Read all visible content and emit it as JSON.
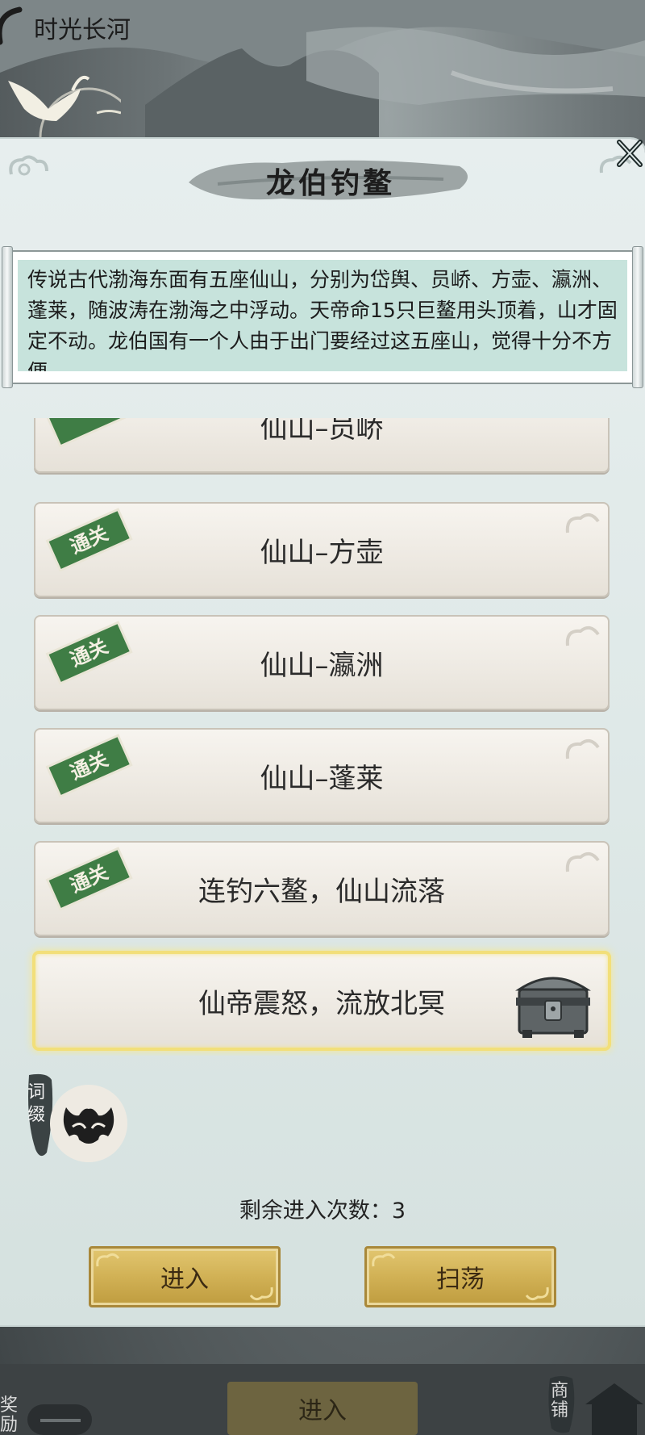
{
  "top_bar": {
    "title": "时光长河"
  },
  "dialog": {
    "title": "龙伯钓鳌",
    "description": "传说古代渤海东面有五座仙山，分别为岱舆、员峤、方壶、瀛洲、蓬莱，随波涛在渤海之中浮动。天帝命15只巨鳌用头顶着，山才固定不动。龙伯国有一个人由于出门要经过这五座山，觉得十分不方便……"
  },
  "stages": [
    {
      "title": "仙山–员峤",
      "status": "通关"
    },
    {
      "title": "仙山–方壶",
      "status": "通关"
    },
    {
      "title": "仙山–瀛洲",
      "status": "通关"
    },
    {
      "title": "仙山–蓬莱",
      "status": "通关"
    },
    {
      "title": "连钓六鳌，仙山流落",
      "status": "通关"
    },
    {
      "title": "仙帝震怒，流放北冥",
      "status": ""
    }
  ],
  "affix": {
    "label": "词缀"
  },
  "remaining": {
    "label": "剩余进入次数：",
    "count": "3"
  },
  "buttons": {
    "enter": "进入",
    "sweep": "扫荡"
  },
  "bottom_nav": {
    "left_label": "奖励",
    "center_button": "进入",
    "right_label": "商铺"
  },
  "colors": {
    "badge_green": "#3f7d45",
    "gold": "#d1b155",
    "scroll_teal": "#c7e3dc",
    "current_glow": "#f2df7a"
  },
  "icons": {
    "close": "close-x-icon",
    "crane": "crane-icon",
    "chest": "treasure-chest-icon",
    "affix": "beast-mask-icon"
  }
}
